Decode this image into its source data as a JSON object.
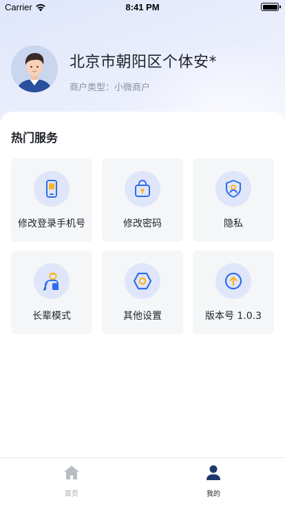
{
  "status_bar": {
    "carrier": "Carrier",
    "time": "8:41 PM"
  },
  "profile": {
    "name": "北京市朝阳区个体安*",
    "merchant_type": "商户类型：小微商户"
  },
  "services": {
    "title": "热门服务",
    "items": [
      {
        "label": "修改登录手机号",
        "icon": "phone-icon"
      },
      {
        "label": "修改密码",
        "icon": "lock-icon"
      },
      {
        "label": "隐私",
        "icon": "shield-icon"
      },
      {
        "label": "长辈模式",
        "icon": "elder-icon"
      },
      {
        "label": "其他设置",
        "icon": "settings-icon"
      },
      {
        "label": "版本号 1.0.3",
        "icon": "upgrade-icon"
      }
    ]
  },
  "tab_bar": {
    "home_label": "首页",
    "mine_label": "我的"
  },
  "colors": {
    "accent_blue": "#2f6bea",
    "accent_yellow": "#f7b72c",
    "icon_circle_bg": "#dfe6f9",
    "card_bg": "#f5f6f8",
    "tab_active": "#1d3a6b",
    "tab_inactive": "#b8bcc4"
  }
}
